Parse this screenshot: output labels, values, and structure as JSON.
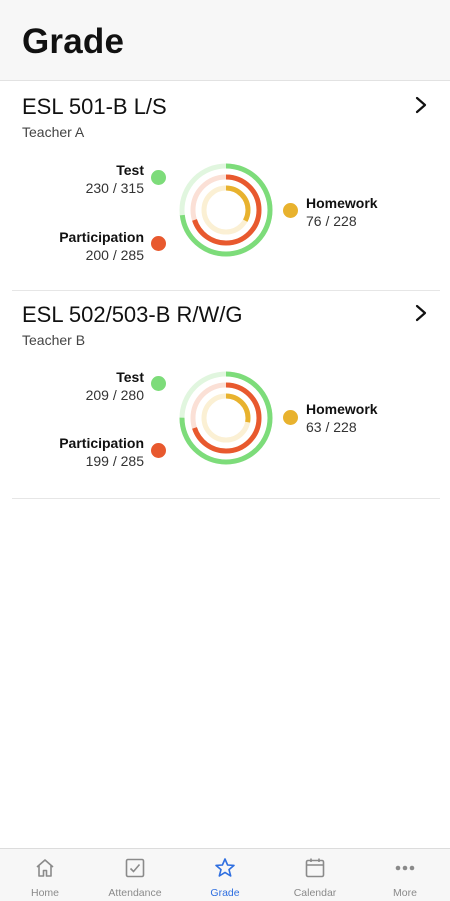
{
  "header": {
    "title": "Grade"
  },
  "courses": [
    {
      "title": "ESL 501-B L/S",
      "teacher": "Teacher A",
      "metrics": {
        "test": {
          "label": "Test",
          "value": "230 / 315",
          "fraction": 0.73
        },
        "participation": {
          "label": "Participation",
          "value": "200 / 285",
          "fraction": 0.7
        },
        "homework": {
          "label": "Homework",
          "value": "76 / 228",
          "fraction": 0.33
        }
      }
    },
    {
      "title": "ESL 502/503-B R/W/G",
      "teacher": "Teacher B",
      "metrics": {
        "test": {
          "label": "Test",
          "value": "209 / 280",
          "fraction": 0.75
        },
        "participation": {
          "label": "Participation",
          "value": "199 / 285",
          "fraction": 0.7
        },
        "homework": {
          "label": "Homework",
          "value": "63 / 228",
          "fraction": 0.28
        }
      }
    }
  ],
  "colors": {
    "test": "#7ddc7a",
    "participation": "#e8592e",
    "homework": "#e8b22e",
    "active_tab": "#2f6fe0"
  },
  "tabbar": {
    "tabs": [
      {
        "label": "Home",
        "icon": "home-icon"
      },
      {
        "label": "Attendance",
        "icon": "checkbox-icon"
      },
      {
        "label": "Grade",
        "icon": "star-icon",
        "active": true
      },
      {
        "label": "Calendar",
        "icon": "calendar-icon"
      },
      {
        "label": "More",
        "icon": "more-icon"
      }
    ]
  }
}
